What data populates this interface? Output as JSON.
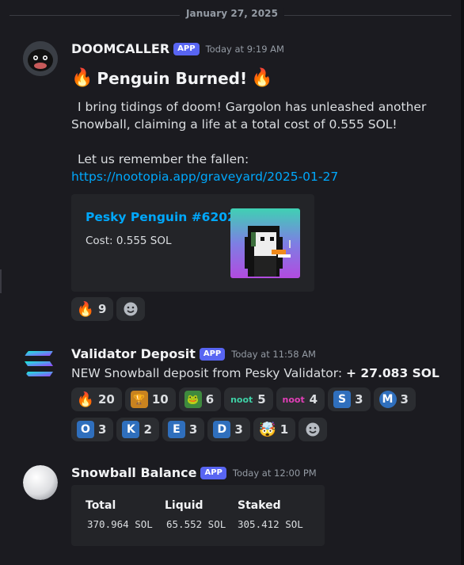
{
  "date_divider": "January 27, 2025",
  "messages": [
    {
      "username": "DOOMCALLER",
      "tag": "APP",
      "timestamp": "Today at 9:19 AM",
      "title": "Penguin Burned!",
      "body_line1": "I bring tidings of doom! Gargolon has unleashed another",
      "body_line2": "Snowball, claiming a life at a total cost of 0.555 SOL!",
      "body_line3": "Let us remember the fallen:",
      "link": "https://nootopia.app/graveyard/2025-01-27",
      "embed": {
        "title": "Pesky Penguin #6202",
        "cost": "Cost: 0.555 SOL"
      },
      "reactions": [
        {
          "emoji": "fire-icon",
          "count": "9"
        }
      ]
    },
    {
      "username": "Validator Deposit",
      "tag": "APP",
      "timestamp": "Today at 11:58 AM",
      "body_prefix": "NEW Snowball deposit from Pesky Validator:",
      "body_amount": "+ 27.083 SOL",
      "reactions_row1": [
        {
          "emoji": "fire-icon",
          "label": "",
          "count": "20"
        },
        {
          "emoji": "trophy-creature-icon",
          "label": "",
          "count": "10"
        },
        {
          "emoji": "green-creature-icon",
          "label": "",
          "count": "6"
        },
        {
          "emoji": "noot-green-icon",
          "label": "noot",
          "count": "5"
        },
        {
          "emoji": "noot-pink-icon",
          "label": "noot",
          "count": "4"
        },
        {
          "emoji": "letter-s-icon",
          "label": "S",
          "count": "3"
        },
        {
          "emoji": "letter-m-icon",
          "label": "M",
          "count": "3"
        }
      ],
      "reactions_row2": [
        {
          "emoji": "letter-o-icon",
          "label": "O",
          "count": "3"
        },
        {
          "emoji": "letter-k-icon",
          "label": "K",
          "count": "2"
        },
        {
          "emoji": "letter-e-icon",
          "label": "E",
          "count": "3"
        },
        {
          "emoji": "letter-d-icon",
          "label": "D",
          "count": "3"
        },
        {
          "emoji": "mind-blown-icon",
          "label": "",
          "count": "1"
        }
      ]
    },
    {
      "username": "Snowball Balance",
      "tag": "APP",
      "timestamp": "Today at 12:00 PM",
      "columns": [
        "Total",
        "Liquid",
        "Staked"
      ],
      "values": [
        "370.964 SOL",
        "65.552 SOL",
        "305.412 SOL"
      ]
    }
  ],
  "colors": {
    "accent": "#5865f2",
    "link": "#00a8fc",
    "embed_title": "#00a8fc",
    "letter_tile": "#2f6fbd"
  }
}
